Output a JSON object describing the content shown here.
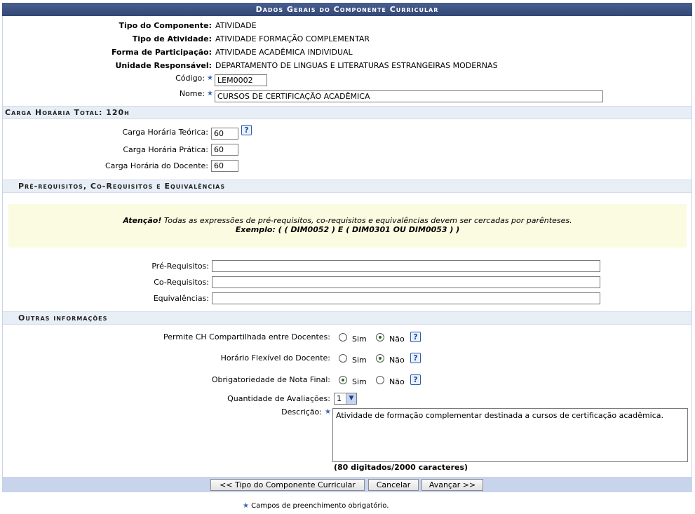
{
  "title": "Dados Gerais do Componente Curricular",
  "general": {
    "tipo_componente_label": "Tipo do Componente:",
    "tipo_componente_value": "ATIVIDADE",
    "tipo_atividade_label": "Tipo de Atividade:",
    "tipo_atividade_value": "ATIVIDADE FORMAÇÃO COMPLEMENTAR",
    "forma_participacao_label": "Forma de Participação:",
    "forma_participacao_value": "ATIVIDADE ACADÊMICA INDIVIDUAL",
    "unidade_label": "Unidade Responsável:",
    "unidade_value": "DEPARTAMENTO DE LINGUAS E LITERATURAS ESTRANGEIRAS MODERNAS",
    "codigo_label": "Código:",
    "codigo_value": "LEM0002",
    "nome_label": "Nome:",
    "nome_value": "CURSOS DE CERTIFICAÇÃO ACADÊMICA"
  },
  "carga": {
    "section_title": "Carga Horária Total: 120h",
    "teorica_label": "Carga Horária Teórica:",
    "teorica_value": "60",
    "pratica_label": "Carga Horária Prática:",
    "pratica_value": "60",
    "docente_label": "Carga Horária do Docente:",
    "docente_value": "60"
  },
  "requisitos": {
    "section_title": "Pré-requisitos, Co-Requisitos e Equivalências",
    "warning_strong": "Atenção!",
    "warning_text": " Todas as expressões de pré-requisitos, co-requisitos e equivalências devem ser cercadas por parênteses.",
    "example": "Exemplo: ( ( DIM0052 ) E ( DIM0301 OU DIM0053 ) )",
    "pre_label": "Pré-Requisitos:",
    "pre_value": "",
    "co_label": "Co-Requisitos:",
    "co_value": "",
    "equiv_label": "Equivalências:",
    "equiv_value": ""
  },
  "outras": {
    "section_title": "Outras informações",
    "ch_compartilhada_label": "Permite CH Compartilhada entre Docentes:",
    "horario_flexivel_label": "Horário Flexível do Docente:",
    "obrigatoriedade_label": "Obrigatoriedade de Nota Final:",
    "sim": "Sim",
    "nao": "Não",
    "quantidade_label": "Quantidade de Avaliações:",
    "quantidade_value": "1",
    "descricao_label": "Descrição:",
    "descricao_value": "Atividade de formação complementar destinada a cursos de certificação acadêmica.",
    "contador": "(80 digitados/2000 caracteres)"
  },
  "buttons": {
    "voltar": "<< Tipo do Componente Curricular",
    "cancelar": "Cancelar",
    "avancar": "Avançar >>"
  },
  "required_note": "Campos de preenchimento obrigatório.",
  "help_glyph": "?",
  "required_glyph": "★",
  "select_arrow": "▼",
  "colors": {
    "header": "#3b5282",
    "section_bg": "#e8eef6",
    "warning_bg": "#fbfbe1",
    "footer_bar": "#c7d4ec",
    "required_star": "#3a65b8"
  }
}
